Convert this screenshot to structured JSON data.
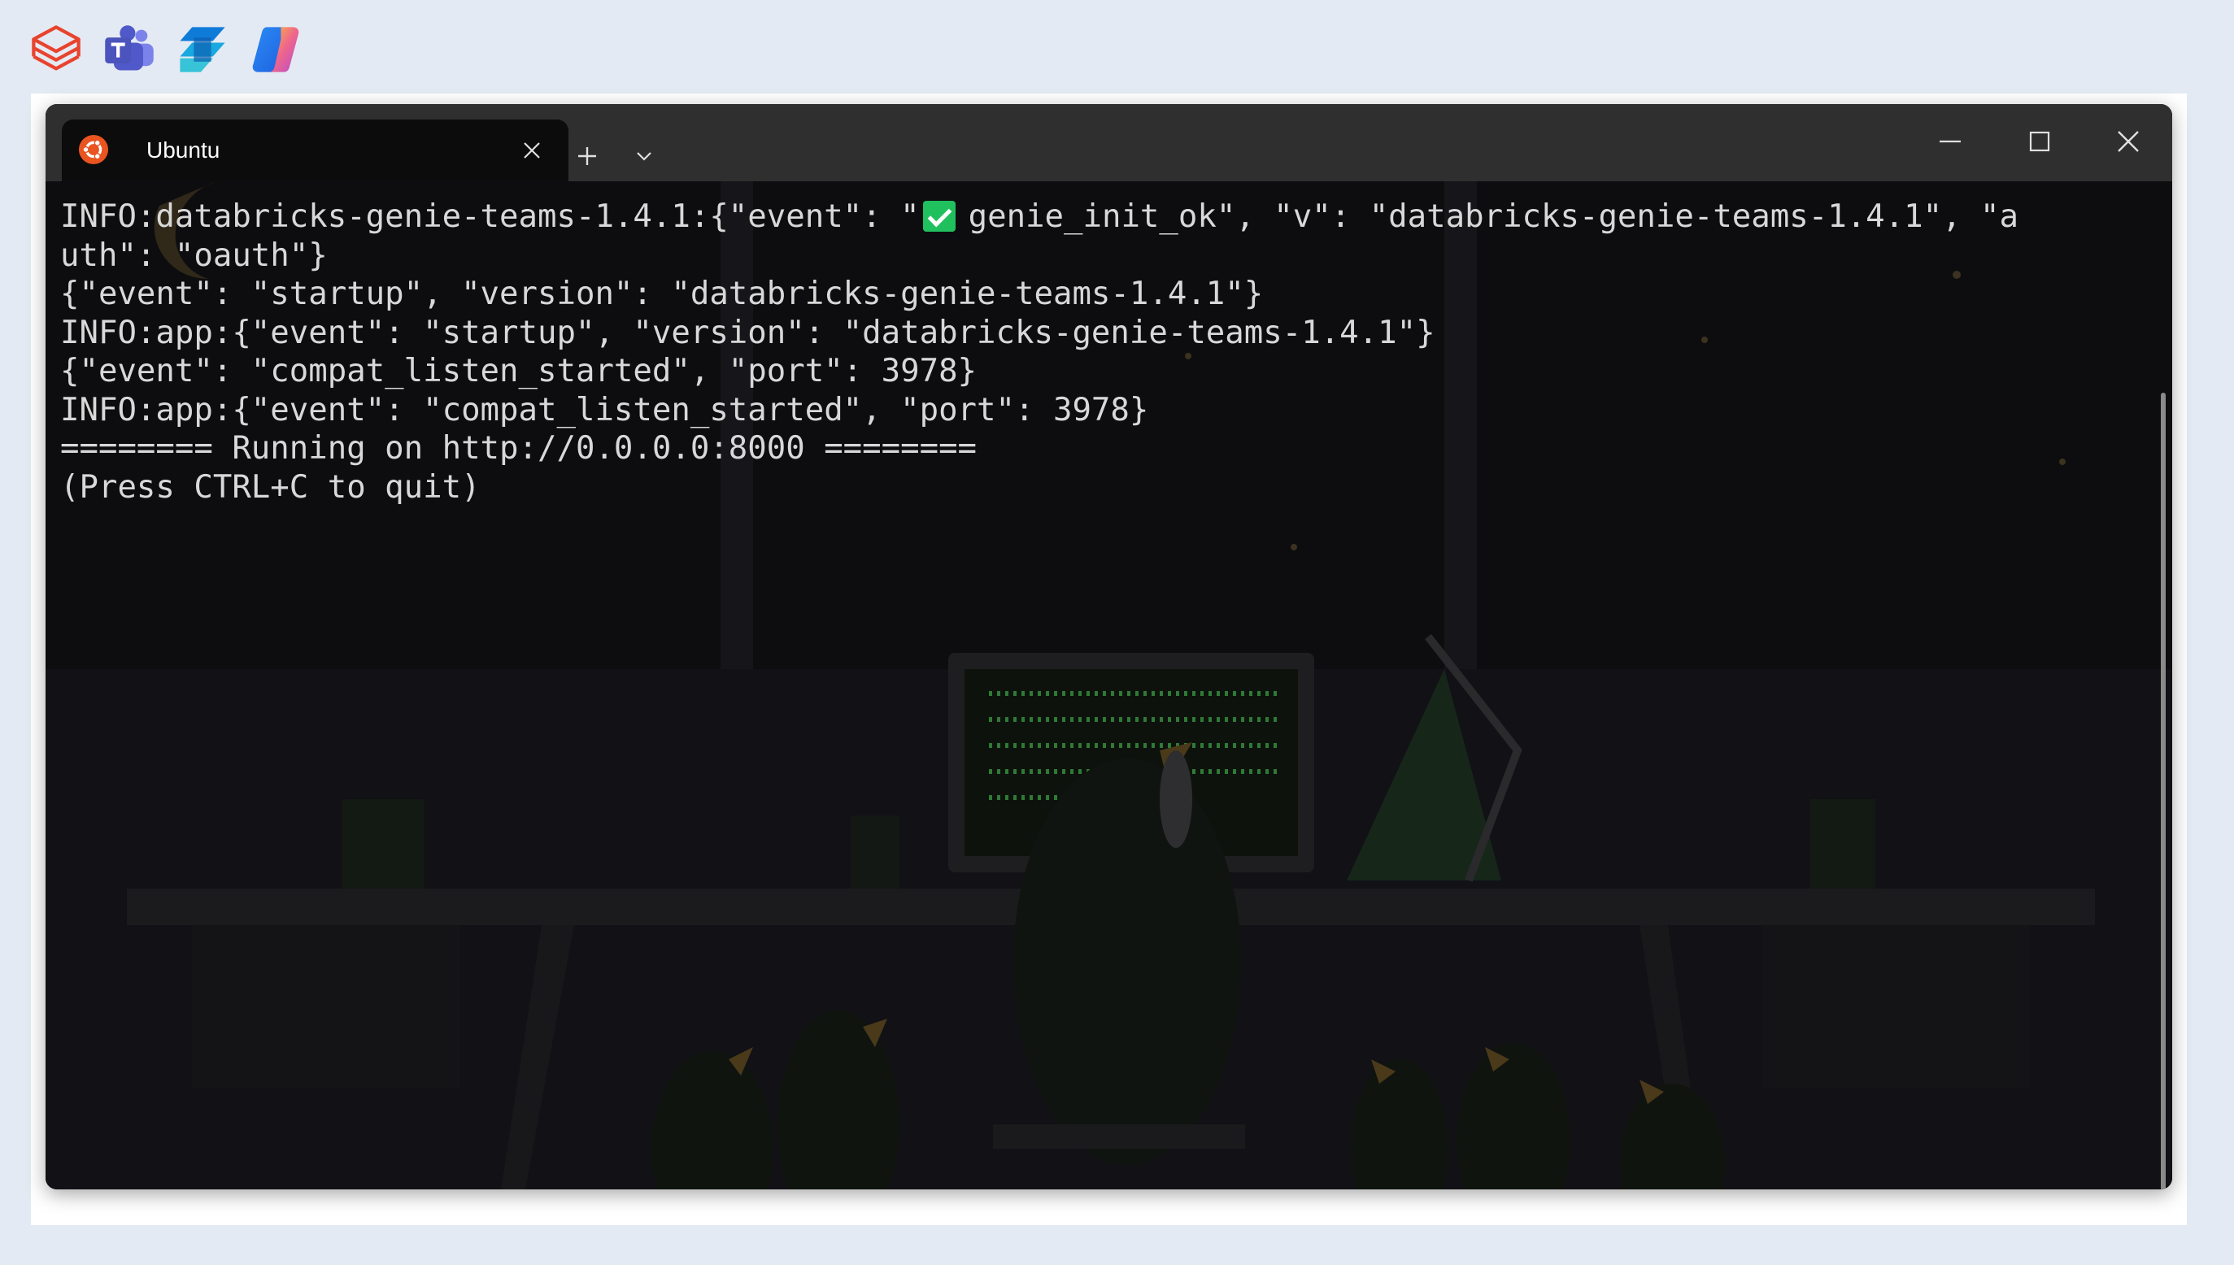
{
  "taskbar": {
    "apps": [
      {
        "icon": "databricks-icon"
      },
      {
        "icon": "teams-icon"
      },
      {
        "icon": "power-automate-icon"
      },
      {
        "icon": "copilot-icon"
      }
    ]
  },
  "window": {
    "tab": {
      "title": "Ubuntu",
      "icon": "ubuntu-icon"
    },
    "controls": {
      "new_tab": "+",
      "minimize": "minimize-icon",
      "maximize": "maximize-icon",
      "close": "close-icon"
    }
  },
  "terminal": {
    "lines": [
      {
        "before": "INFO:databricks-genie-teams-1.4.1:{\"event\": \"",
        "after": "genie_init_ok\", \"v\": \"databricks-genie-teams-1.4.1\", \"a"
      },
      {
        "text": "uth\": \"oauth\"}"
      },
      {
        "text": "{\"event\": \"startup\", \"version\": \"databricks-genie-teams-1.4.1\"}"
      },
      {
        "text": "INFO:app:{\"event\": \"startup\", \"version\": \"databricks-genie-teams-1.4.1\"}"
      },
      {
        "text": "{\"event\": \"compat_listen_started\", \"port\": 3978}"
      },
      {
        "text": "INFO:app:{\"event\": \"compat_listen_started\", \"port\": 3978}"
      },
      {
        "text": "======== Running on http://0.0.0.0:8000 ========"
      },
      {
        "text": "(Press CTRL+C to quit)"
      }
    ]
  },
  "colors": {
    "accent": "#21c05f",
    "titlebar": "#2f2f2f",
    "terminal_bg": "#0a0a0c"
  }
}
